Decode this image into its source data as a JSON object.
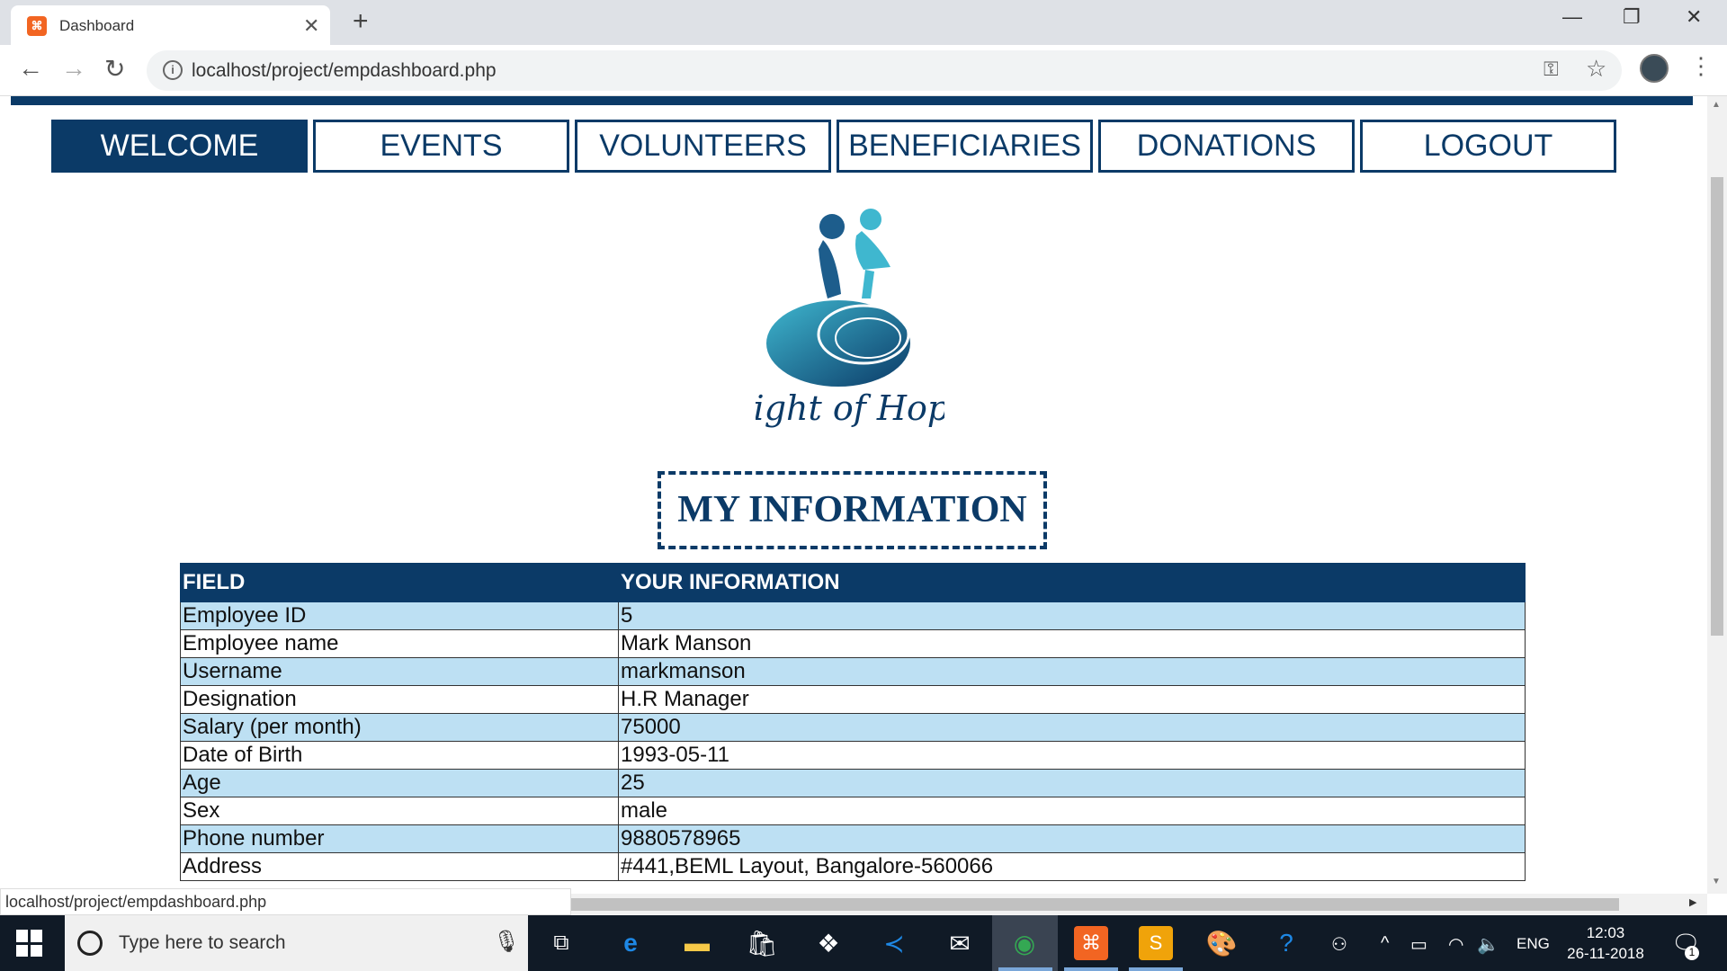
{
  "browser": {
    "tab_title": "Dashboard",
    "tab_favicon": "xampp-icon",
    "tab_close": "✕",
    "new_tab": "+",
    "url": "localhost/project/empdashboard.php",
    "status_url": "localhost/project/empdashboard.php",
    "window_controls": {
      "minimize": "—",
      "maximize": "❐",
      "close": "✕"
    }
  },
  "nav": {
    "items": [
      {
        "label": "WELCOME",
        "active": true
      },
      {
        "label": "EVENTS",
        "active": false
      },
      {
        "label": "VOLUNTEERS",
        "active": false
      },
      {
        "label": "BENEFICIARIES",
        "active": false
      },
      {
        "label": "DONATIONS",
        "active": false
      },
      {
        "label": "LOGOUT",
        "active": false
      }
    ]
  },
  "logo": {
    "text": "Light of Hope"
  },
  "section_title": "MY INFORMATION",
  "table": {
    "headers": [
      "FIELD",
      "YOUR INFORMATION"
    ],
    "rows": [
      [
        "Employee ID",
        "5"
      ],
      [
        "Employee name",
        "Mark Manson"
      ],
      [
        "Username",
        "markmanson"
      ],
      [
        "Designation",
        "H.R Manager"
      ],
      [
        "Salary (per month)",
        "75000"
      ],
      [
        "Date of Birth",
        "1993-05-11"
      ],
      [
        "Age",
        "25"
      ],
      [
        "Sex",
        "male"
      ],
      [
        "Phone number",
        "9880578965"
      ],
      [
        "Address",
        "#441,BEML Layout, Bangalore-560066"
      ]
    ]
  },
  "taskbar": {
    "search_placeholder": "Type here to search",
    "language": "ENG",
    "time": "12:03",
    "date": "26-11-2018",
    "notification_count": "1"
  },
  "colors": {
    "brand_navy": "#0b3a67",
    "row_highlight": "#bde0f3",
    "taskbar": "#101a26"
  }
}
